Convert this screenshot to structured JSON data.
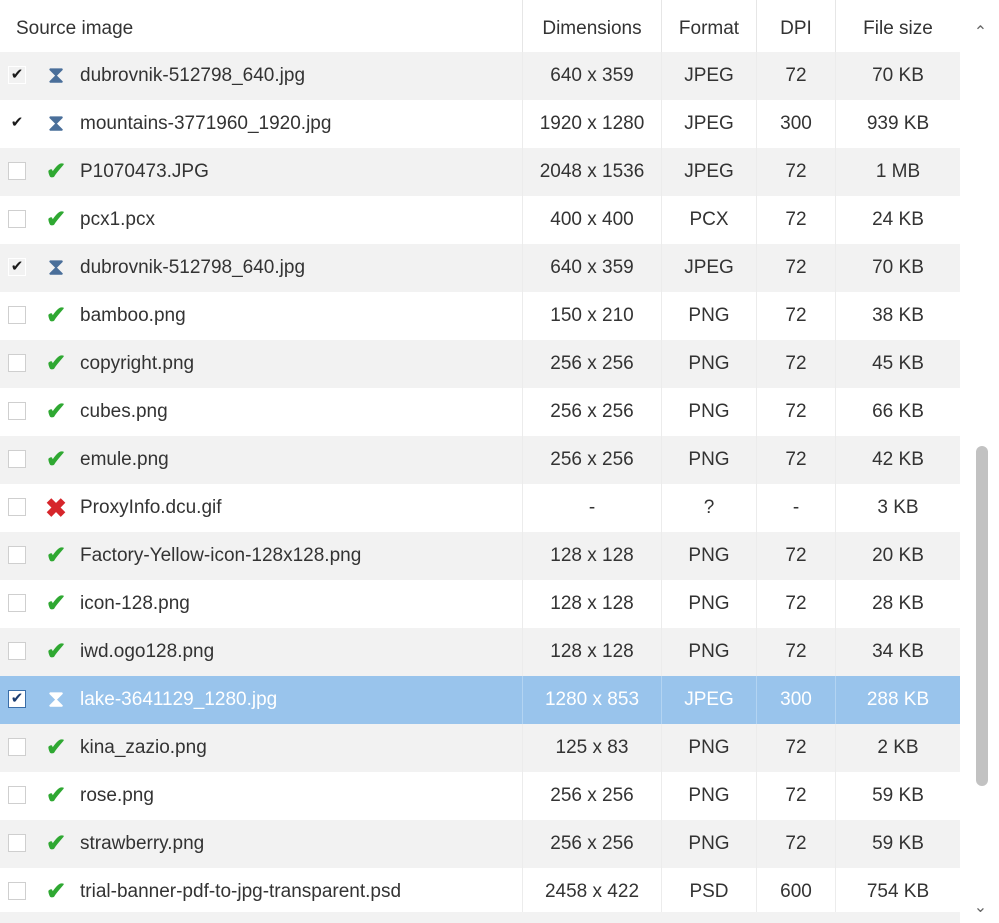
{
  "columns": {
    "source": "Source image",
    "dimensions": "Dimensions",
    "format": "Format",
    "dpi": "DPI",
    "file_size": "File size"
  },
  "rows": [
    {
      "checked": true,
      "status": "processing",
      "name": "dubrovnik-512798_640.jpg",
      "dimensions": "640 x 359",
      "format": "JPEG",
      "dpi": "72",
      "size": "70 KB"
    },
    {
      "checked": true,
      "status": "processing",
      "name": "mountains-3771960_1920.jpg",
      "dimensions": "1920 x 1280",
      "format": "JPEG",
      "dpi": "300",
      "size": "939 KB"
    },
    {
      "checked": false,
      "status": "ok",
      "name": "P1070473.JPG",
      "dimensions": "2048 x 1536",
      "format": "JPEG",
      "dpi": "72",
      "size": "1 MB"
    },
    {
      "checked": false,
      "status": "ok",
      "name": "pcx1.pcx",
      "dimensions": "400 x 400",
      "format": "PCX",
      "dpi": "72",
      "size": "24 KB"
    },
    {
      "checked": true,
      "status": "processing",
      "name": "dubrovnik-512798_640.jpg",
      "dimensions": "640 x 359",
      "format": "JPEG",
      "dpi": "72",
      "size": "70 KB"
    },
    {
      "checked": false,
      "status": "ok",
      "name": "bamboo.png",
      "dimensions": "150 x 210",
      "format": "PNG",
      "dpi": "72",
      "size": "38 KB"
    },
    {
      "checked": false,
      "status": "ok",
      "name": "copyright.png",
      "dimensions": "256 x 256",
      "format": "PNG",
      "dpi": "72",
      "size": "45 KB"
    },
    {
      "checked": false,
      "status": "ok",
      "name": "cubes.png",
      "dimensions": "256 x 256",
      "format": "PNG",
      "dpi": "72",
      "size": "66 KB"
    },
    {
      "checked": false,
      "status": "ok",
      "name": "emule.png",
      "dimensions": "256 x 256",
      "format": "PNG",
      "dpi": "72",
      "size": "42 KB"
    },
    {
      "checked": false,
      "status": "error",
      "name": "ProxyInfo.dcu.gif",
      "dimensions": "-",
      "format": "?",
      "dpi": "-",
      "size": "3 KB"
    },
    {
      "checked": false,
      "status": "ok",
      "name": "Factory-Yellow-icon-128x128.png",
      "dimensions": "128 x 128",
      "format": "PNG",
      "dpi": "72",
      "size": "20 KB"
    },
    {
      "checked": false,
      "status": "ok",
      "name": "icon-128.png",
      "dimensions": "128 x 128",
      "format": "PNG",
      "dpi": "72",
      "size": "28 KB"
    },
    {
      "checked": false,
      "status": "ok",
      "name": "iwd.ogo128.png",
      "dimensions": "128 x 128",
      "format": "PNG",
      "dpi": "72",
      "size": "34 KB"
    },
    {
      "checked": true,
      "status": "processing",
      "selected": true,
      "name": "lake-3641129_1280.jpg",
      "dimensions": "1280 x 853",
      "format": "JPEG",
      "dpi": "300",
      "size": "288 KB"
    },
    {
      "checked": false,
      "status": "ok",
      "name": "kina_zazio.png",
      "dimensions": "125 x 83",
      "format": "PNG",
      "dpi": "72",
      "size": "2 KB"
    },
    {
      "checked": false,
      "status": "ok",
      "name": "rose.png",
      "dimensions": "256 x 256",
      "format": "PNG",
      "dpi": "72",
      "size": "59 KB"
    },
    {
      "checked": false,
      "status": "ok",
      "name": "strawberry.png",
      "dimensions": "256 x 256",
      "format": "PNG",
      "dpi": "72",
      "size": "59 KB"
    },
    {
      "checked": false,
      "status": "ok",
      "name": "trial-banner-pdf-to-jpg-transparent.psd",
      "dimensions": "2458 x 422",
      "format": "PSD",
      "dpi": "600",
      "size": "754 KB"
    }
  ],
  "icons": {
    "checkmark": "check-glyph",
    "ok": "green-check-icon",
    "error": "red-x-icon",
    "processing": "hourglass-icon",
    "scroll_up": "chevron-up-icon",
    "scroll_down": "chevron-down-icon"
  },
  "colors": {
    "selected_row": "#99c4ec",
    "alt_row": "#f2f2f2",
    "ok_icon": "#2fa832",
    "error_icon": "#d6262b"
  }
}
